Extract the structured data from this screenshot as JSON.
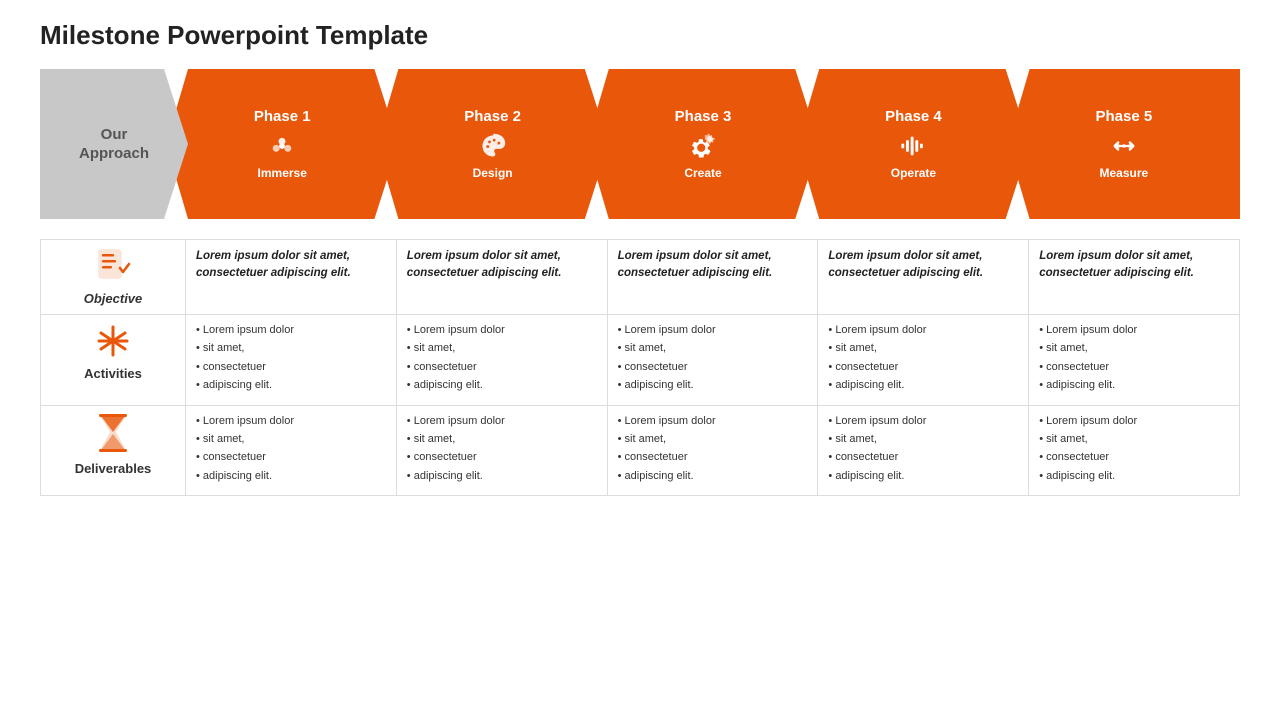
{
  "title": "Milestone Powerpoint Template",
  "approach_label": "Our\nApproach",
  "phases": [
    {
      "id": 1,
      "label": "Phase 1",
      "sublabel": "Immerse",
      "icon": "immerse"
    },
    {
      "id": 2,
      "label": "Phase 2",
      "sublabel": "Design",
      "icon": "design"
    },
    {
      "id": 3,
      "label": "Phase 3",
      "sublabel": "Create",
      "icon": "create"
    },
    {
      "id": 4,
      "label": "Phase 4",
      "sublabel": "Operate",
      "icon": "operate"
    },
    {
      "id": 5,
      "label": "Phase 5",
      "sublabel": "Measure",
      "icon": "measure"
    }
  ],
  "rows": [
    {
      "label": "Objective",
      "icon_type": "checklist",
      "italic": true,
      "content": [
        "Lorem ipsum dolor sit amet, consectetuer adipiscing elit.",
        "Lorem ipsum dolor sit amet, consectetuer adipiscing elit.",
        "Lorem ipsum dolor sit amet, consectetuer adipiscing elit.",
        "Lorem ipsum dolor sit amet, consectetuer adipiscing elit.",
        "Lorem ipsum dolor sit amet, consectetuer adipiscing elit."
      ]
    },
    {
      "label": "Activities",
      "icon_type": "activities",
      "italic": false,
      "content": [
        "Lorem ipsum dolor\nsit amet,\nconsectetuer\nadipiscing elit.",
        "Lorem ipsum dolor\nsit amet,\nconsectetuer\nadipiscing elit.",
        "Lorem ipsum dolor\nsit amet,\nconsectetuer\nadipiscing elit.",
        "Lorem ipsum dolor\nsit amet,\nconsectetuer\nadipiscing elit.",
        "Lorem ipsum dolor\nsit amet,\nconsectetuer\nadipiscing elit."
      ]
    },
    {
      "label": "Deliverables",
      "icon_type": "hourglass",
      "italic": false,
      "content": [
        "Lorem ipsum dolor\nsit amet,\nconsectetuer\nadipiscing elit.",
        "Lorem ipsum dolor\nsit amet,\nconsectetuer\nadipiscing elit.",
        "Lorem ipsum dolor\nsit amet,\nconsectetuer\nadipiscing elit.",
        "Lorem ipsum dolor\nsit amet,\nconsectetuer\nadipiscing elit.",
        "Lorem ipsum dolor\nsit amet,\nconsectetuer\nadipiscing elit."
      ]
    }
  ],
  "colors": {
    "orange": "#E8570A",
    "gray": "#c8c8c8",
    "dark_gray": "#aaaaaa"
  }
}
